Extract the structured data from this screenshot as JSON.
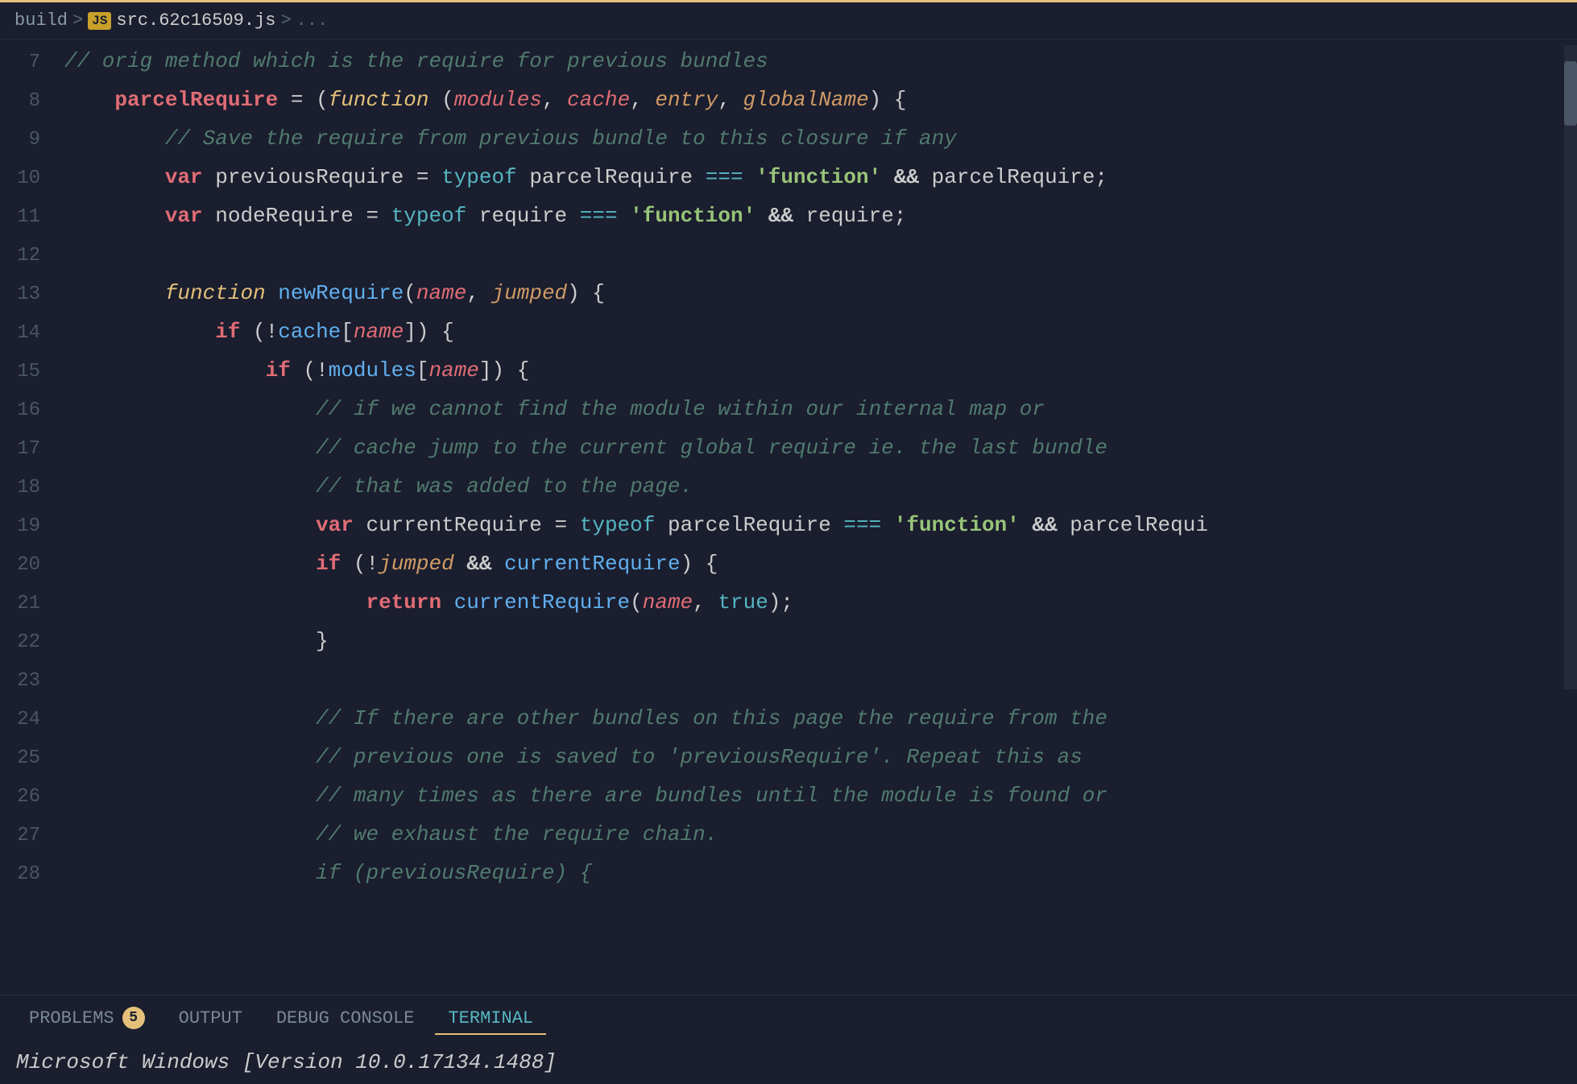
{
  "breadcrumb": {
    "items": [
      "build",
      ">",
      "JS",
      "src.62c16509.js",
      ">",
      "..."
    ]
  },
  "panel": {
    "tabs": [
      {
        "id": "problems",
        "label": "PROBLEMS",
        "badge": "5",
        "active": false
      },
      {
        "id": "output",
        "label": "OUTPUT",
        "badge": null,
        "active": false
      },
      {
        "id": "debug-console",
        "label": "DEBUG CONSOLE",
        "badge": null,
        "active": false
      },
      {
        "id": "terminal",
        "label": "TERMINAL",
        "badge": null,
        "active": true
      }
    ],
    "terminal_line": "Microsoft Windows [Version 10.0.17134.1488]"
  },
  "code": {
    "lines": [
      {
        "num": "7",
        "content": "comment_orig_method"
      },
      {
        "num": "8",
        "content": "parcelRequire_line"
      },
      {
        "num": "9",
        "content": "comment_save_require"
      },
      {
        "num": "10",
        "content": "var_prev_require"
      },
      {
        "num": "11",
        "content": "var_node_require"
      },
      {
        "num": "12",
        "content": "empty"
      },
      {
        "num": "13",
        "content": "function_new_require"
      },
      {
        "num": "14",
        "content": "if_cache"
      },
      {
        "num": "15",
        "content": "if_modules"
      },
      {
        "num": "16",
        "content": "comment_cannot_find"
      },
      {
        "num": "17",
        "content": "comment_cache_jump"
      },
      {
        "num": "18",
        "content": "comment_added_page"
      },
      {
        "num": "19",
        "content": "var_current_require"
      },
      {
        "num": "20",
        "content": "if_jumped"
      },
      {
        "num": "21",
        "content": "return_current"
      },
      {
        "num": "22",
        "content": "close_brace_1"
      },
      {
        "num": "23",
        "content": "empty"
      },
      {
        "num": "24",
        "content": "comment_if_there"
      },
      {
        "num": "25",
        "content": "comment_previous_one"
      },
      {
        "num": "26",
        "content": "comment_many_times"
      },
      {
        "num": "27",
        "content": "comment_we_exhaust"
      },
      {
        "num": "28",
        "content": "comment_if_prev_partial"
      }
    ]
  }
}
